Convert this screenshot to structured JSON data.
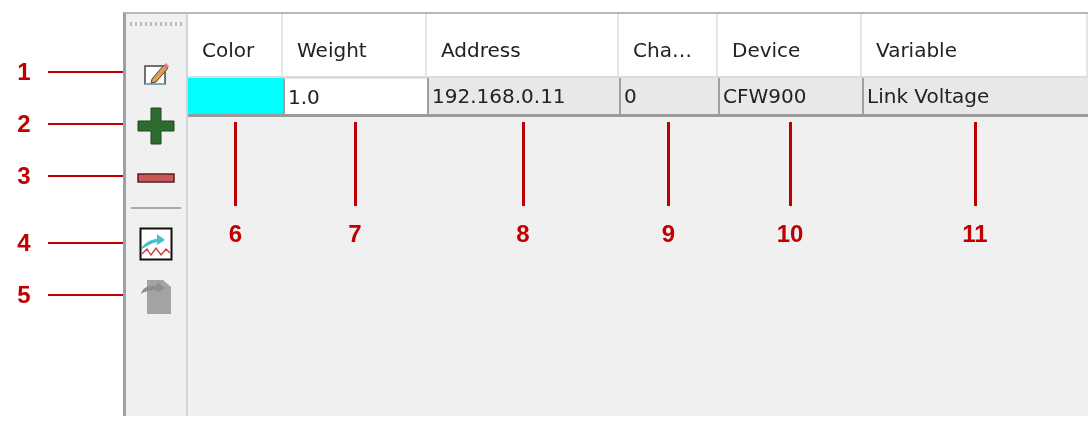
{
  "toolbar": [
    {
      "kind": "edit",
      "callout": "1",
      "disabled": false
    },
    {
      "kind": "add",
      "callout": "2",
      "disabled": false
    },
    {
      "kind": "remove",
      "callout": "3",
      "disabled": false
    },
    {
      "kind": "separator"
    },
    {
      "kind": "chart",
      "callout": "4",
      "disabled": false
    },
    {
      "kind": "export",
      "callout": "5",
      "disabled": true
    }
  ],
  "table": {
    "columns": [
      {
        "label": "Color",
        "callout": "6"
      },
      {
        "label": "Weight",
        "callout": "7"
      },
      {
        "label": "Address",
        "callout": "8"
      },
      {
        "label": "Cha…",
        "callout": "9"
      },
      {
        "label": "Device",
        "callout": "10"
      },
      {
        "label": "Variable",
        "callout": "11"
      }
    ],
    "rows": [
      {
        "color": "#00ffff",
        "weight": "1.0",
        "address": "192.168.0.11",
        "column_4": "0",
        "device": "CFW900",
        "variable": "Link Voltage"
      }
    ]
  }
}
